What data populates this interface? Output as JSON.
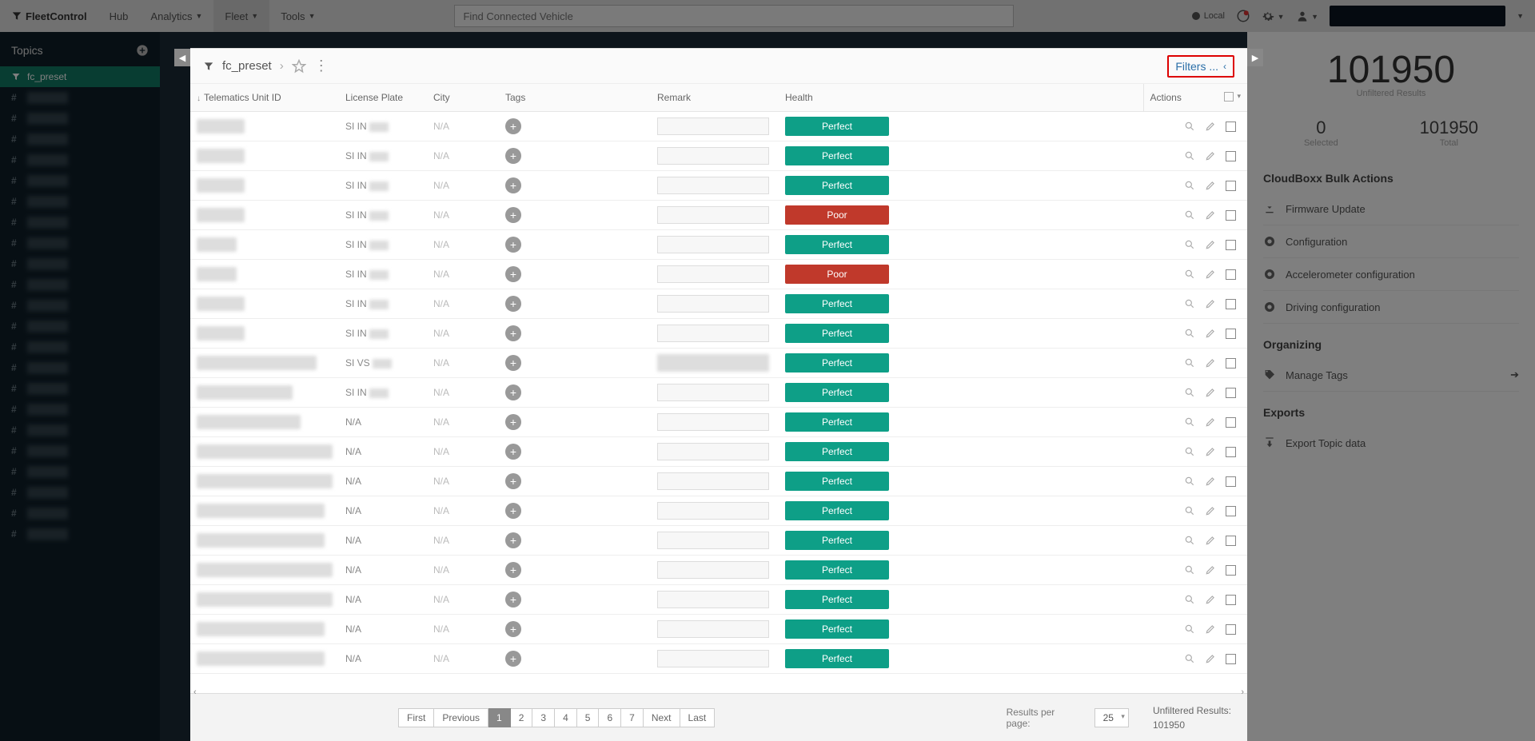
{
  "brand": "FleetControl",
  "nav": {
    "hub": "Hub",
    "analytics": "Analytics",
    "fleet": "Fleet",
    "tools": "Tools"
  },
  "search_placeholder": "Find Connected Vehicle",
  "top_right": {
    "local": "Local"
  },
  "topics": {
    "title": "Topics",
    "active": "fc_preset",
    "count": 22
  },
  "modal": {
    "crumb": "fc_preset",
    "filters_label": "Filters ...",
    "columns": {
      "id": "Telematics Unit ID",
      "plate": "License Plate",
      "city": "City",
      "tags": "Tags",
      "remark": "Remark",
      "health": "Health",
      "actions": "Actions"
    },
    "rows": [
      {
        "plate": "SI IN",
        "city": "N/A",
        "health": "Perfect",
        "id_w": 60
      },
      {
        "plate": "SI IN",
        "city": "N/A",
        "health": "Perfect",
        "id_w": 60
      },
      {
        "plate": "SI IN",
        "city": "N/A",
        "health": "Perfect",
        "id_w": 60
      },
      {
        "plate": "SI IN",
        "city": "N/A",
        "health": "Poor",
        "id_w": 60
      },
      {
        "plate": "SI IN",
        "city": "N/A",
        "health": "Perfect",
        "id_w": 50
      },
      {
        "plate": "SI IN",
        "city": "N/A",
        "health": "Poor",
        "id_w": 50
      },
      {
        "plate": "SI IN",
        "city": "N/A",
        "health": "Perfect",
        "id_w": 60
      },
      {
        "plate": "SI IN",
        "city": "N/A",
        "health": "Perfect",
        "id_w": 60
      },
      {
        "plate": "SI VS",
        "city": "N/A",
        "health": "Perfect",
        "id_w": 150,
        "remark_blur": true
      },
      {
        "plate": "SI IN",
        "city": "N/A",
        "health": "Perfect",
        "id_w": 120
      },
      {
        "plate": "N/A",
        "city": "N/A",
        "health": "Perfect",
        "id_w": 130
      },
      {
        "plate": "N/A",
        "city": "N/A",
        "health": "Perfect",
        "id_w": 170
      },
      {
        "plate": "N/A",
        "city": "N/A",
        "health": "Perfect",
        "id_w": 170
      },
      {
        "plate": "N/A",
        "city": "N/A",
        "health": "Perfect",
        "id_w": 160
      },
      {
        "plate": "N/A",
        "city": "N/A",
        "health": "Perfect",
        "id_w": 160
      },
      {
        "plate": "N/A",
        "city": "N/A",
        "health": "Perfect",
        "id_w": 170
      },
      {
        "plate": "N/A",
        "city": "N/A",
        "health": "Perfect",
        "id_w": 170
      },
      {
        "plate": "N/A",
        "city": "N/A",
        "health": "Perfect",
        "id_w": 160
      },
      {
        "plate": "N/A",
        "city": "N/A",
        "health": "Perfect",
        "id_w": 160
      }
    ],
    "pager": {
      "first": "First",
      "prev": "Previous",
      "pages": [
        "1",
        "2",
        "3",
        "4",
        "5",
        "6",
        "7"
      ],
      "next": "Next",
      "last": "Last",
      "active": "1"
    },
    "rpp_label": "Results per page:",
    "rpp_value": "25",
    "unfiltered_label": "Unfiltered Results:",
    "unfiltered_value": "101950"
  },
  "right": {
    "big": "101950",
    "big_label": "Unfiltered Results",
    "selected_n": "0",
    "selected_l": "Selected",
    "total_n": "101950",
    "total_l": "Total",
    "bulk_title": "CloudBoxx Bulk Actions",
    "bulk": [
      "Firmware Update",
      "Configuration",
      "Accelerometer configuration",
      "Driving configuration"
    ],
    "org_title": "Organizing",
    "org_item": "Manage Tags",
    "exp_title": "Exports",
    "exp_item": "Export Topic data"
  }
}
